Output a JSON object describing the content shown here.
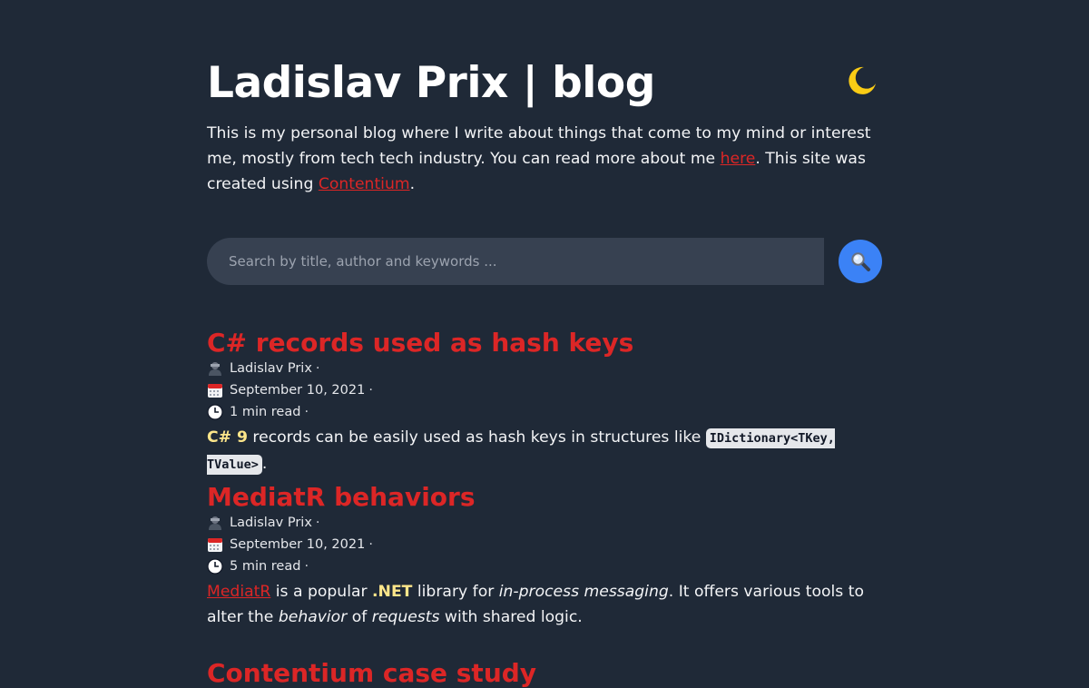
{
  "header": {
    "title": "Ladislav Prix | blog",
    "intro_text_1": "This is my personal blog where I write about things that come to my mind or interest me, mostly from tech tech industry. You can read more about me ",
    "intro_link_here": "here",
    "intro_text_2": ". This site was created using ",
    "intro_link_contentium": "Contentium",
    "intro_text_3": ".",
    "theme_icon": "moon-icon"
  },
  "search": {
    "placeholder": "Search by title, author and keywords ...",
    "value": "",
    "button_icon": "magnifier-icon"
  },
  "posts": [
    {
      "title": "C# records used as hash keys",
      "author": "Ladislav Prix",
      "date": "September 10, 2021",
      "read_time": "1 min read",
      "excerpt_hl": "C# 9",
      "excerpt_1": " records can be easily used as hash keys in structures like ",
      "excerpt_code": "IDictionary<TKey, TValue>",
      "excerpt_2": "."
    },
    {
      "title": "MediatR behaviors",
      "author": "Ladislav Prix",
      "date": "September 10, 2021",
      "read_time": "5 min read",
      "excerpt_link": "MediatR",
      "excerpt_1": " is a popular ",
      "excerpt_hl": ".NET",
      "excerpt_2": " library for ",
      "excerpt_em1": "in-process messaging",
      "excerpt_3": ". It offers various tools to alter the ",
      "excerpt_em2": "behavior",
      "excerpt_4": " of ",
      "excerpt_em3": "requests",
      "excerpt_5": " with shared logic."
    },
    {
      "title": "Contentium case study"
    }
  ],
  "meta_separator": "·",
  "icons": {
    "author": "person-icon",
    "date": "calendar-icon",
    "read_time": "clock-icon"
  },
  "colors": {
    "background": "#1f2937",
    "accent_red": "#dc2626",
    "search_button": "#3b82f6",
    "highlight": "#fde68a",
    "moon": "#facc15"
  }
}
